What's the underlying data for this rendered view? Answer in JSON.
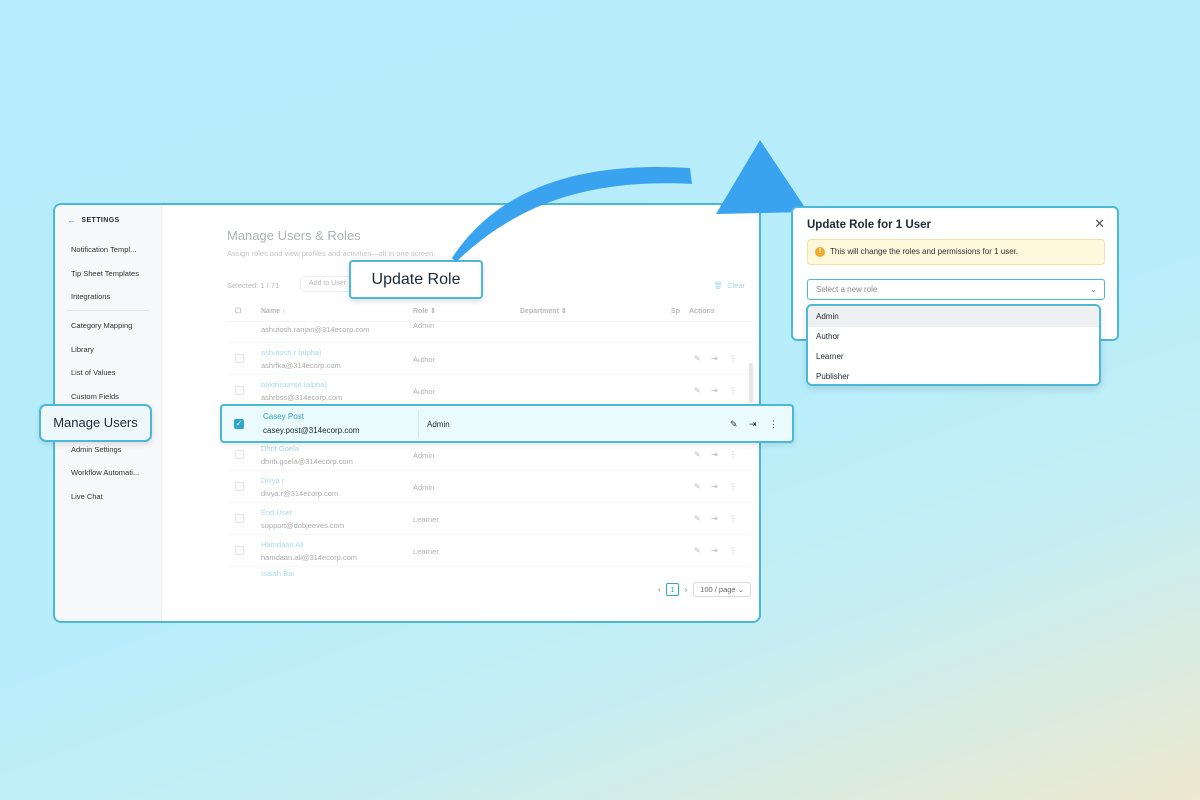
{
  "sidebar": {
    "back_label": "SETTINGS",
    "items": [
      {
        "label": "Notification Templ..."
      },
      {
        "label": "Tip Sheet Templates"
      },
      {
        "label": "Integrations"
      },
      {
        "label": "Category Mapping"
      },
      {
        "label": "Library"
      },
      {
        "label": "List of Values"
      },
      {
        "label": "Custom Fields"
      },
      {
        "label": "Admin Settings"
      },
      {
        "label": "Workflow Automati..."
      },
      {
        "label": "Live Chat"
      }
    ],
    "highlighted_item": "Manage Users"
  },
  "main": {
    "title": "Manage Users & Roles",
    "subtitle": "Assign roles and view profiles and activities—all in one screen.",
    "selected_count": "Selected: 1 / 71",
    "add_to_user_label": "Add to User",
    "clear_label": "Clear",
    "columns": [
      "Name",
      "Role",
      "Department",
      "Sp",
      "Actions"
    ],
    "rows": [
      {
        "name": "",
        "email": "ashutosh.ranjan@314ecorp.com",
        "role": "Admin"
      },
      {
        "name": "ashutosh.r (alpha)",
        "email": "ashrfka@314ecorp.com",
        "role": "Author"
      },
      {
        "name": "bakthisumpt (alpha)",
        "email": "ashrbss@314ecorp.com",
        "role": "Author"
      },
      {
        "name": "Dhrit Goela",
        "email": "dhriti.goela@314ecorp.com",
        "role": "Admin"
      },
      {
        "name": "Divya r",
        "email": "divya.r@314ecorp.com",
        "role": "Admin"
      },
      {
        "name": "End User",
        "email": "support@dobjeeves.com",
        "role": "Learner"
      },
      {
        "name": "Hamdaan Ali",
        "email": "hamdaan.ali@314ecorp.com",
        "role": "Learner"
      },
      {
        "name": "Isaiah Bai",
        "email": "",
        "role": ""
      }
    ],
    "selected_row": {
      "name": "Casey Post",
      "email": "casey.post@314ecorp.com",
      "role": "Admin"
    },
    "pagination": {
      "page": "1",
      "page_size": "100 / page"
    }
  },
  "callouts": {
    "manage_users": "Manage Users",
    "update_role": "Update Role"
  },
  "modal": {
    "title": "Update Role for 1 User",
    "warning": "This will change the roles and permissions for 1 user.",
    "select_placeholder": "Select a new role",
    "options": [
      "Admin",
      "Author",
      "Learner",
      "Publisher"
    ]
  },
  "colors": {
    "accent": "#4bb8d8",
    "link": "#2aa7c9",
    "warning_bg": "#fdf7dc"
  }
}
